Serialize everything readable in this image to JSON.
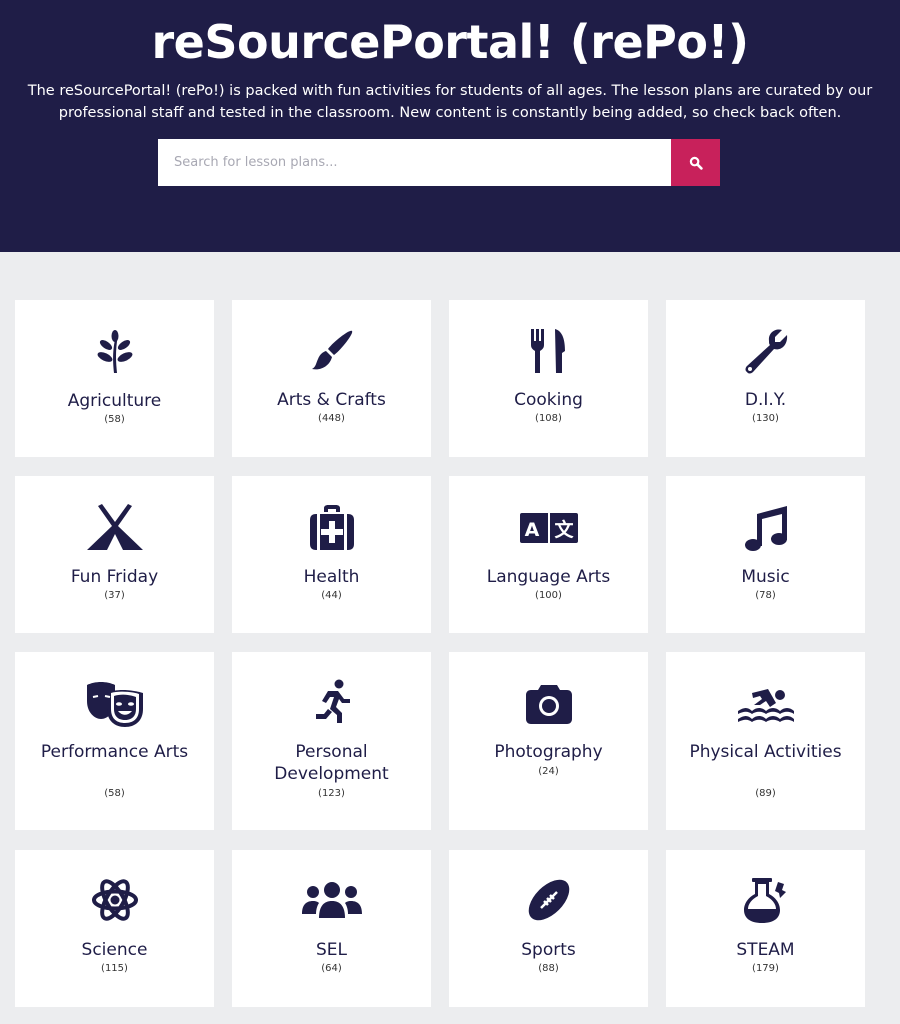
{
  "header": {
    "title": "reSourcePortal! (rePo!)",
    "description": "The reSourcePortal! (rePo!) is packed with fun activities for students of all ages. The lesson plans are curated by our professional staff and tested in the classroom. New content is constantly being added, so check back often."
  },
  "search": {
    "placeholder": "Search for lesson plans...",
    "value": "",
    "button_icon": "search-icon"
  },
  "colors": {
    "header_bg": "#1f1d47",
    "accent": "#c8215b",
    "page_bg": "#ecedef",
    "card_bg": "#ffffff",
    "text": "#1f1d47"
  },
  "categories": [
    {
      "name": "Agriculture",
      "count": "(58)",
      "icon": "seedling-icon"
    },
    {
      "name": "Arts & Crafts",
      "count": "(448)",
      "icon": "paintbrush-icon"
    },
    {
      "name": "Cooking",
      "count": "(108)",
      "icon": "utensils-icon"
    },
    {
      "name": "D.I.Y.",
      "count": "(130)",
      "icon": "wrench-icon"
    },
    {
      "name": "Fun Friday",
      "count": "(37)",
      "icon": "tent-icon"
    },
    {
      "name": "Health",
      "count": "(44)",
      "icon": "medkit-icon"
    },
    {
      "name": "Language Arts",
      "count": "(100)",
      "icon": "language-icon"
    },
    {
      "name": "Music",
      "count": "(78)",
      "icon": "music-icon"
    },
    {
      "name": "Performance Arts",
      "count": "(58)",
      "icon": "theater-masks-icon"
    },
    {
      "name": "Personal Development",
      "count": "(123)",
      "icon": "running-icon"
    },
    {
      "name": "Photography",
      "count": "(24)",
      "icon": "camera-icon"
    },
    {
      "name": "Physical Activities",
      "count": "(89)",
      "icon": "swimmer-icon"
    },
    {
      "name": "Science",
      "count": "(115)",
      "icon": "atom-icon"
    },
    {
      "name": "SEL",
      "count": "(64)",
      "icon": "users-icon"
    },
    {
      "name": "Sports",
      "count": "(88)",
      "icon": "football-icon"
    },
    {
      "name": "STEAM",
      "count": "(179)",
      "icon": "flask-icon"
    }
  ]
}
